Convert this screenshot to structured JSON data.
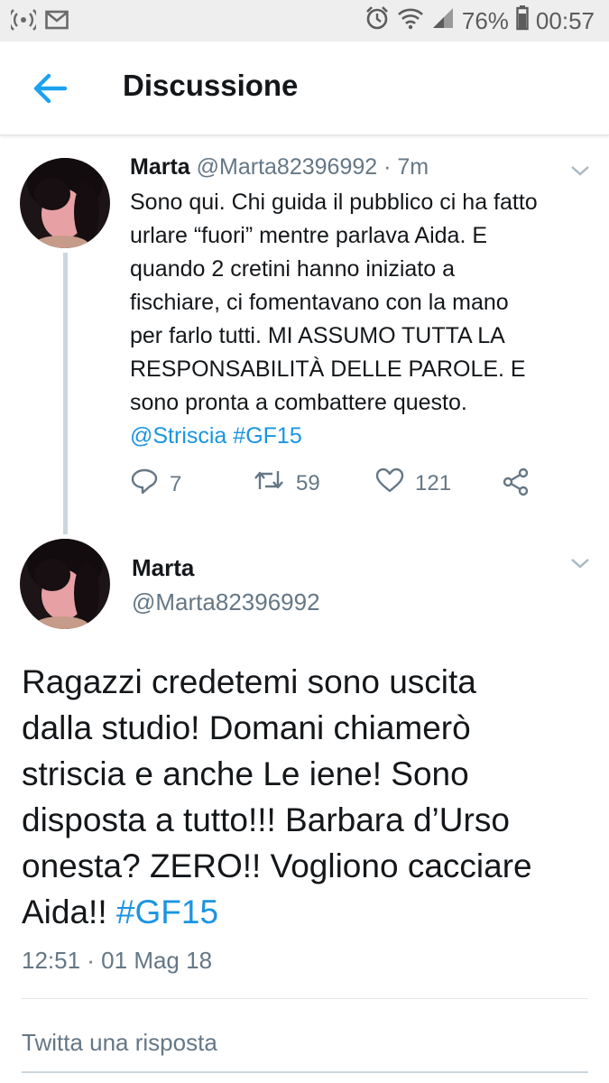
{
  "status_bar": {
    "battery": "76%",
    "time": "00:57",
    "icons": [
      "hotspot-icon",
      "mail-icon",
      "alarm-icon",
      "wifi-icon",
      "signal-icon",
      "battery-icon"
    ]
  },
  "header": {
    "title": "Discussione",
    "back_icon": "arrow-left-icon"
  },
  "colors": {
    "accent": "#1da1f2",
    "link": "#1b95e0",
    "secondary_text": "#657786",
    "thread_line": "#ccd6dd"
  },
  "tweet1": {
    "name": "Marta",
    "handle": "@Marta82396992",
    "age": "7m",
    "text_lines": [
      "Sono qui. Chi guida il pubblico ci ha fatto",
      "urlare “fuori” mentre parlava Aida. E",
      "quando 2 cretini hanno iniziato a",
      "fischiare, ci fomentavano con la mano",
      "per farlo tutti. MI ASSUMO TUTTA LA",
      "RESPONSABILITÀ DELLE PAROLE. E",
      "sono pronta a combattere questo."
    ],
    "mention": "@Striscia",
    "hashtag": "#GF15",
    "replies": "7",
    "retweets": "59",
    "likes": "121"
  },
  "tweet2": {
    "name": "Marta",
    "handle": "@Marta82396992",
    "text_lines": [
      "Ragazzi credetemi sono uscita",
      "dalla studio! Domani chiamerò",
      "striscia e anche Le iene! Sono",
      "disposta a tutto!!! Barbara d’Urso",
      "onesta? ZERO!! Vogliono cacciare"
    ],
    "last_line": "Aida!!",
    "hashtag": "#GF15",
    "timestamp": "12:51 · 01 Mag 18"
  },
  "reply": {
    "placeholder": "Twitta una risposta"
  }
}
